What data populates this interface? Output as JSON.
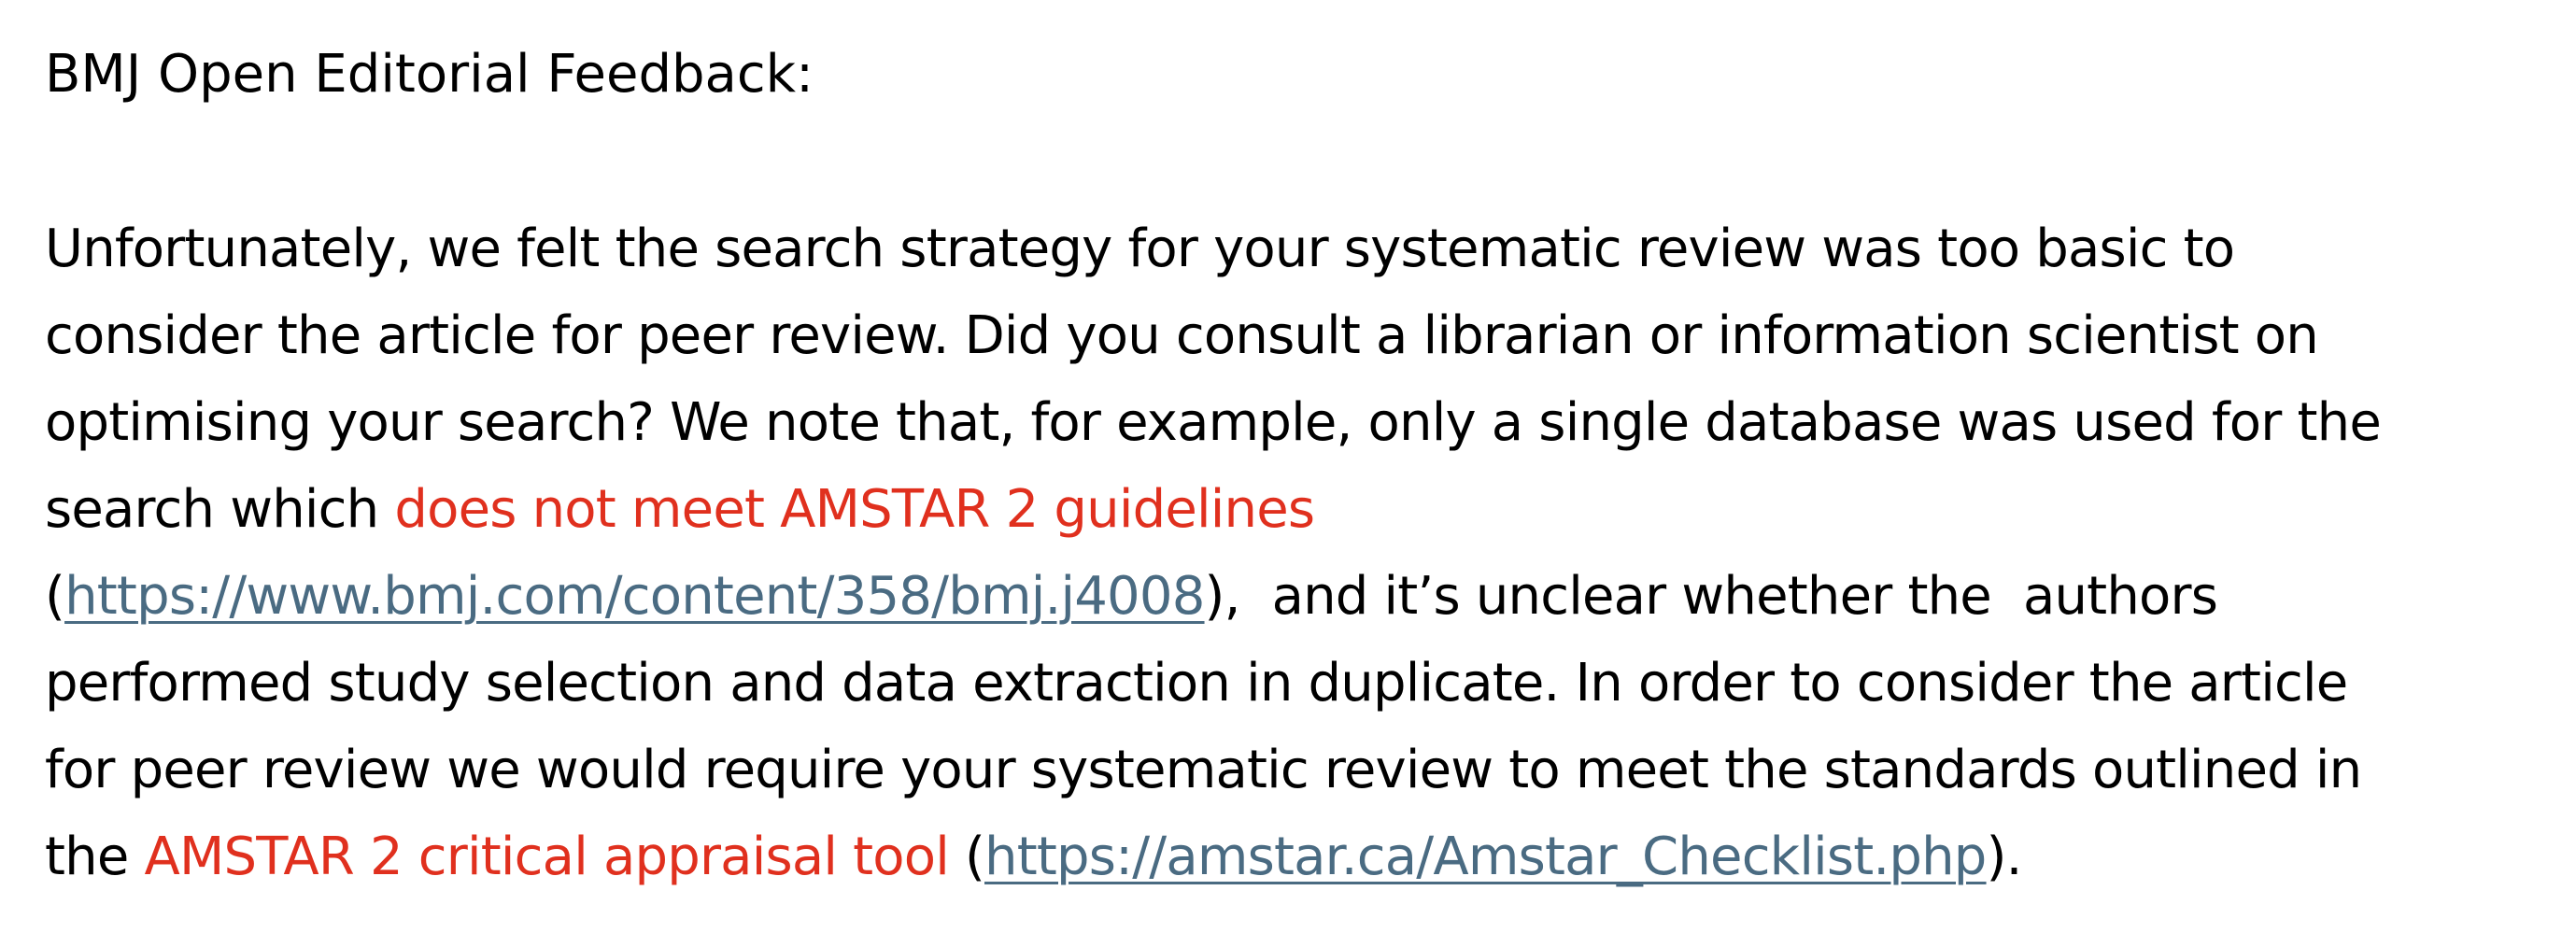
{
  "heading": "BMJ Open Editorial Feedback:",
  "paragraph": {
    "line1": "Unfortunately, we felt the search strategy for your systematic review was too basic to",
    "line2": "consider the article for peer review. Did you consult a librarian or information scientist on",
    "line3": "optimising your search? We note that, for example, only a single database was used for the",
    "line4_pre": "search which ",
    "line4_red": "does not meet AMSTAR 2 guidelines",
    "line5_open": "(",
    "line5_link": "https://www.bmj.com/content/358/bmj.j4008",
    "line5_post": "),  and it’s unclear whether the  authors",
    "line6": "performed study selection and data extraction in duplicate. In order to consider the article",
    "line7": "for peer review we would require your systematic review to meet the standards outlined in",
    "line8_pre": "the ",
    "line8_red": "AMSTAR 2 critical appraisal tool",
    "line8_open": " (",
    "line8_link": "https://amstar.ca/Amstar_Checklist.php",
    "line8_post": ")."
  },
  "colors": {
    "text": "#000000",
    "highlight": "#e0301e",
    "link": "#4a6b82"
  }
}
